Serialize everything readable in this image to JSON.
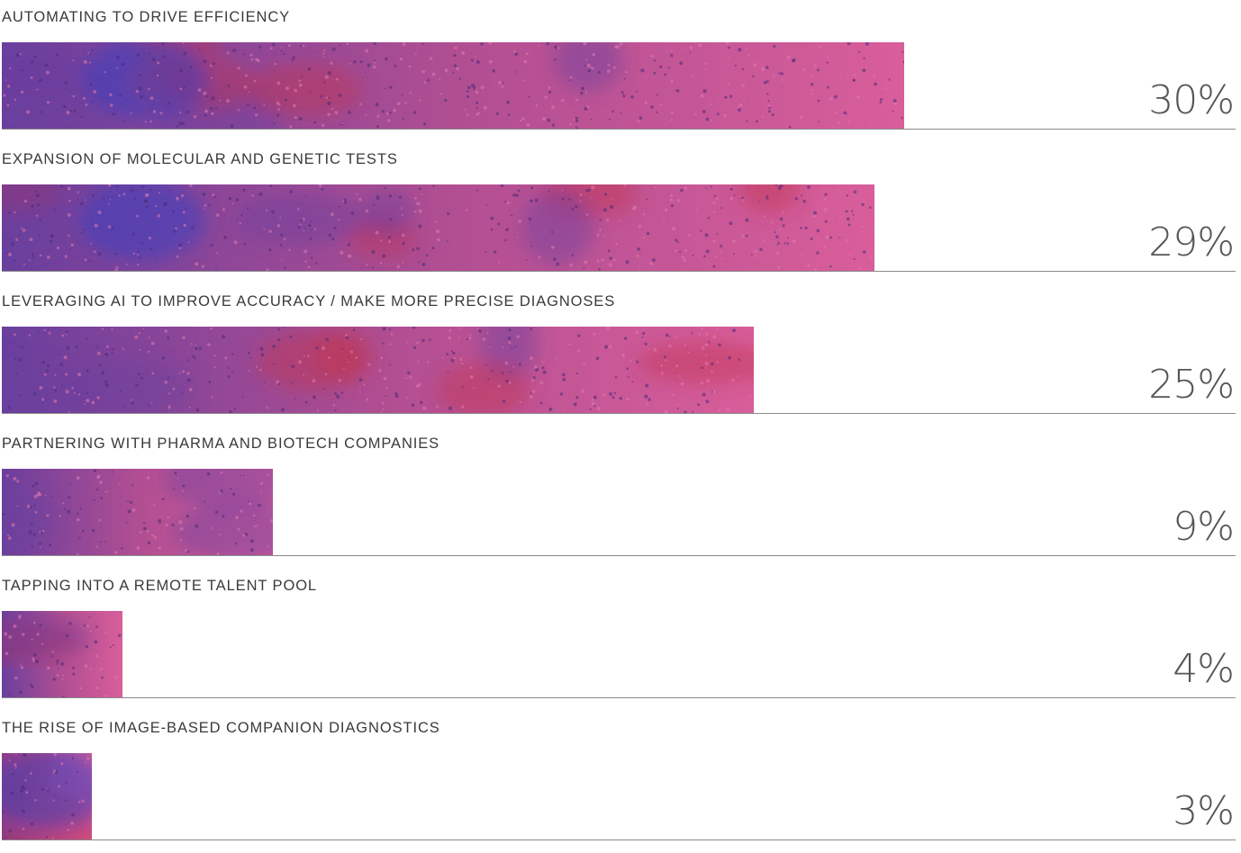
{
  "chart_data": {
    "type": "bar",
    "orientation": "horizontal",
    "title": "",
    "xlabel": "",
    "ylabel": "",
    "xlim": [
      0,
      41
    ],
    "grid": false,
    "legend": "none",
    "categories": [
      "AUTOMATING TO DRIVE EFFICIENCY",
      "EXPANSION OF MOLECULAR AND GENETIC TESTS",
      "LEVERAGING AI TO IMPROVE ACCURACY / MAKE MORE PRECISE DIAGNOSES",
      "PARTNERING WITH PHARMA AND BIOTECH COMPANIES",
      "TAPPING INTO A REMOTE TALENT POOL",
      "THE RISE OF IMAGE-BASED COMPANION DIAGNOSTICS"
    ],
    "values": [
      30,
      29,
      25,
      9,
      4,
      3
    ],
    "value_labels": [
      "30%",
      "29%",
      "25%",
      "9%",
      "4%",
      "3%"
    ],
    "colors": {
      "bar_base": "#b04e92",
      "bar_pink": "#d85e9a",
      "bar_purple": "#6a3f9e",
      "heat_red": "#c0334e",
      "heat_blue": "#3a3fc0",
      "label_text": "#3a3a3a",
      "value_text": "#555555",
      "baseline": "#8a8a8a"
    }
  }
}
